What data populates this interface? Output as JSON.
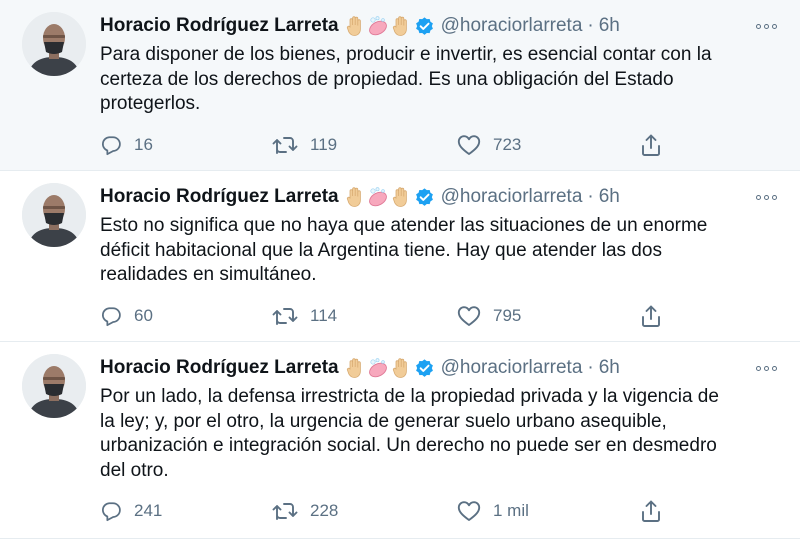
{
  "tweets": [
    {
      "author": "Horacio Rodríguez Larreta",
      "handle": "@horaciorlarreta",
      "separator": "·",
      "time": "6h",
      "lines": [
        "Para disponer de los bienes, producir e invertir, es esencial contar con la",
        "certeza de los derechos de propiedad. Es una obligación del Estado",
        "protegerlos."
      ],
      "replies": "16",
      "retweets": "119",
      "likes": "723"
    },
    {
      "author": "Horacio Rodríguez Larreta",
      "handle": "@horaciorlarreta",
      "separator": "·",
      "time": "6h",
      "lines": [
        "Esto no significa que no haya que atender las situaciones de un enorme",
        "déficit habitacional que la Argentina tiene. Hay que atender las dos",
        "realidades en simultáneo."
      ],
      "replies": "60",
      "retweets": "114",
      "likes": "795"
    },
    {
      "author": "Horacio Rodríguez Larreta",
      "handle": "@horaciorlarreta",
      "separator": "·",
      "time": "6h",
      "lines": [
        "Por un lado, la defensa irrestricta de la propiedad privada y la vigencia de",
        "la ley; y, por el otro, la urgencia de generar suelo urbano asequible,",
        "urbanización e integración social. Un derecho no puede ser en desmedro",
        "del otro."
      ],
      "replies": "241",
      "retweets": "228",
      "likes": "1 mil"
    }
  ],
  "name_emojis": [
    "raised-hand-icon",
    "soap-icon",
    "raised-hand-icon"
  ],
  "colors": {
    "text": "#0f1419",
    "secondary": "#5b7083",
    "verified": "#1da1f2",
    "highlight_bg": "#f5f8fa",
    "divider": "#e6ecf0"
  }
}
